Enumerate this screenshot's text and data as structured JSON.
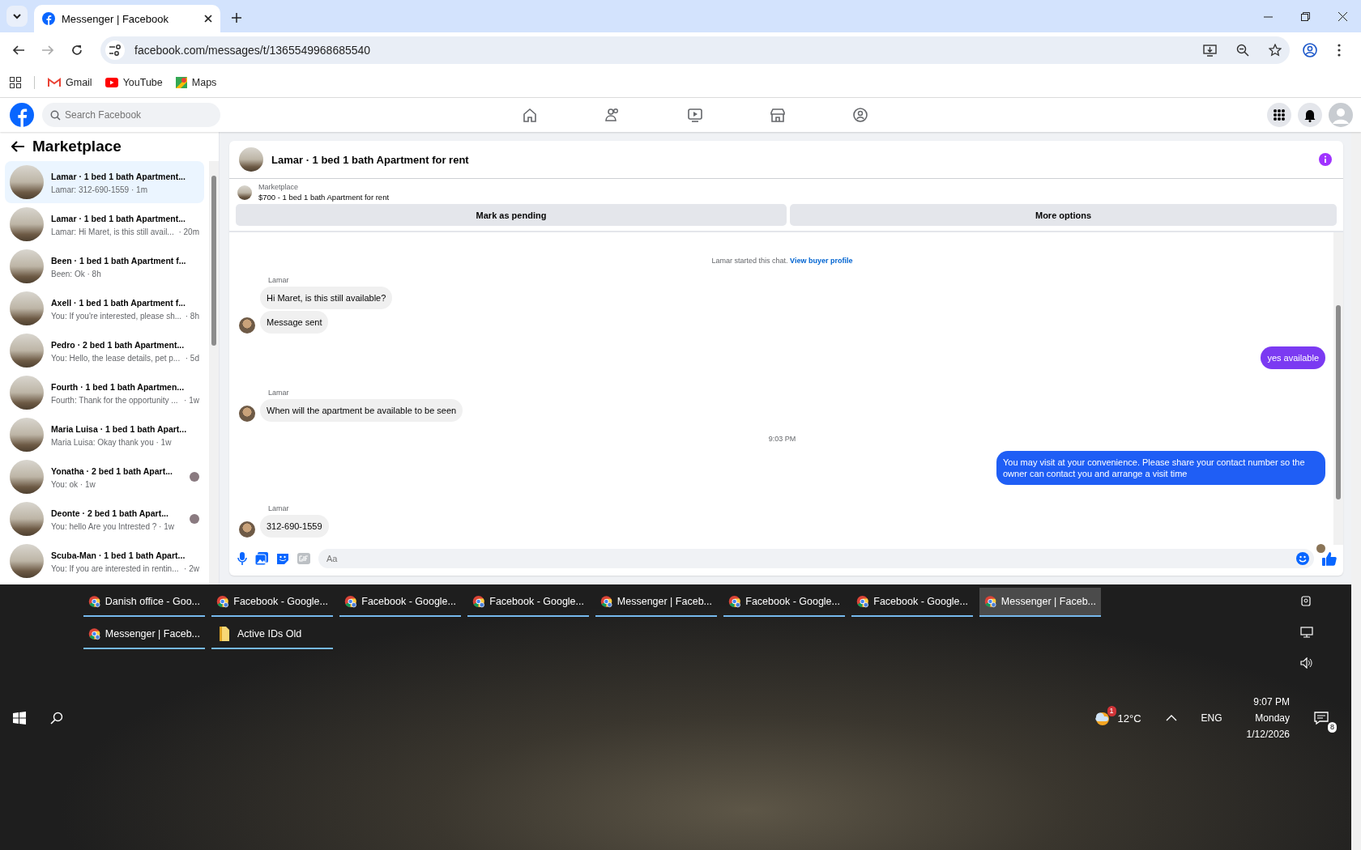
{
  "browser": {
    "tab_title": "Messenger | Facebook",
    "url": "facebook.com/messages/t/1365549968685540",
    "bookmarks": [
      {
        "label": "Gmail",
        "kind": "gmail"
      },
      {
        "label": "YouTube",
        "kind": "youtube"
      },
      {
        "label": "Maps",
        "kind": "maps"
      }
    ]
  },
  "facebook": {
    "search_placeholder": "Search Facebook"
  },
  "sidebar": {
    "title": "Marketplace",
    "conversations": [
      {
        "title": "Lamar · 1 bed 1 bath Apartment...",
        "preview": "Lamar: 312-690-1559 · 1m",
        "selected": true,
        "seen": false
      },
      {
        "title": "Lamar · 1 bed 1 bath Apartment...",
        "preview": "Lamar: Hi Maret, is this still avail...",
        "time": "· 20m",
        "selected": false,
        "seen": false
      },
      {
        "title": "Been · 1 bed 1 bath Apartment f...",
        "preview": "Been: Ok · 8h",
        "selected": false,
        "seen": false
      },
      {
        "title": "Axell · 1 bed 1 bath Apartment f...",
        "preview": "You: If you're interested, please sh...",
        "time": "· 8h",
        "selected": false,
        "seen": false
      },
      {
        "title": "Pedro · 2 bed 1 bath Apartment...",
        "preview": "You: Hello, the lease details, pet p...",
        "time": "· 5d",
        "selected": false,
        "seen": false
      },
      {
        "title": "Fourth · 1 bed 1 bath Apartmen...",
        "preview": "Fourth: Thank for the opportunity ...",
        "time": "· 1w",
        "selected": false,
        "seen": false
      },
      {
        "title": "Maria Luisa · 1 bed 1 bath Apart...",
        "preview": "Maria Luisa: Okay thank you · 1w",
        "selected": false,
        "seen": false
      },
      {
        "title": "Yonatha · 2 bed 1 bath Apart...",
        "preview": "You: ok · 1w",
        "selected": false,
        "seen": true
      },
      {
        "title": "Deonte · 2 bed 1 bath Apart...",
        "preview": "You: hello Are you Intrested ? · 1w",
        "selected": false,
        "seen": true
      },
      {
        "title": "Scuba-Man · 1 bed 1 bath Apart...",
        "preview": "You: If you are interested in rentin...",
        "time": "· 2w",
        "selected": false,
        "seen": false
      }
    ]
  },
  "chat": {
    "title": "Lamar · 1 bed 1 bath Apartment for rent",
    "listing": {
      "label": "Marketplace",
      "item": "$700 - 1 bed 1 bath Apartment for rent"
    },
    "buttons": [
      "Mark as pending",
      "More options"
    ],
    "intro": {
      "text": "Lamar started this chat.",
      "link": "View buyer profile"
    },
    "messages": [
      {
        "kind": "incoming",
        "sender": "Lamar",
        "text": "Hi Maret, is this still available?",
        "avatar": false
      },
      {
        "kind": "incoming",
        "text": "Message sent",
        "avatar": true
      },
      {
        "kind": "outgoing",
        "text": "yes available",
        "color": "#7b3af2"
      },
      {
        "kind": "incoming",
        "sender": "Lamar",
        "text": "When will the apartment be available to be seen",
        "avatar": true
      },
      {
        "kind": "time",
        "text": "9:03 PM"
      },
      {
        "kind": "outgoing",
        "text": "You may visit at your convenience. Please share your contact number so the owner can contact you and arrange a visit time",
        "color": "#1f5ef5"
      },
      {
        "kind": "incoming",
        "sender": "Lamar",
        "text": "312-690-1559",
        "avatar": true
      }
    ],
    "composer_placeholder": "Aa"
  },
  "taskbar": {
    "windows": [
      {
        "label": "Danish office - Goo...",
        "kind": "chrome",
        "selected": false
      },
      {
        "label": "Facebook - Google...",
        "kind": "chrome",
        "selected": false
      },
      {
        "label": "Facebook - Google...",
        "kind": "chrome",
        "selected": false
      },
      {
        "label": "Facebook - Google...",
        "kind": "chrome",
        "selected": false
      },
      {
        "label": "Messenger | Faceb...",
        "kind": "chrome",
        "selected": false
      },
      {
        "label": "Facebook - Google...",
        "kind": "chrome",
        "selected": false
      },
      {
        "label": "Facebook - Google...",
        "kind": "chrome",
        "selected": false
      },
      {
        "label": "Messenger | Faceb...",
        "kind": "chrome",
        "selected": true
      },
      {
        "label": "Messenger | Faceb...",
        "kind": "chrome",
        "selected": false
      },
      {
        "label": "Active IDs Old",
        "kind": "folder",
        "selected": false
      }
    ],
    "weather_badge": "1",
    "temperature": "12°C",
    "language": "ENG",
    "time": "9:07 PM",
    "day": "Monday",
    "date": "1/12/2026",
    "notifications": "8"
  }
}
